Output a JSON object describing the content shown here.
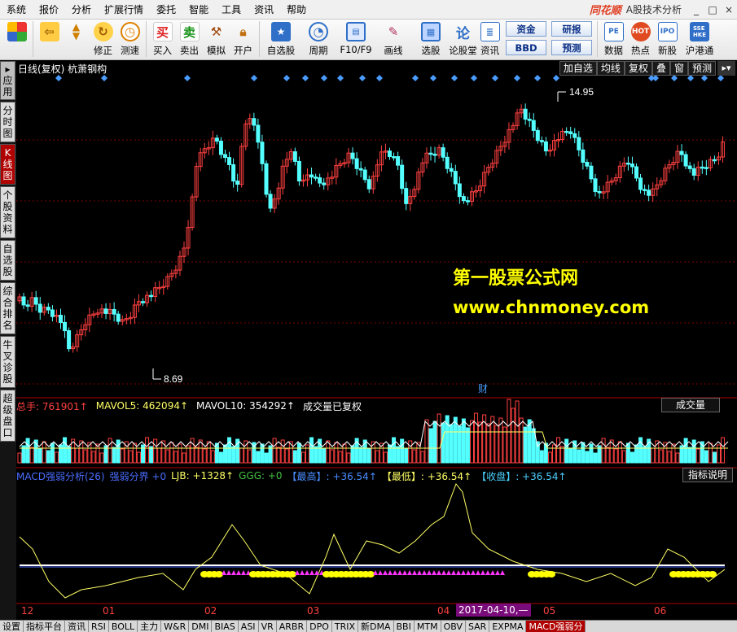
{
  "menu": [
    "系统",
    "报价",
    "分析",
    "扩展行情",
    "委托",
    "智能",
    "工具",
    "资讯",
    "帮助"
  ],
  "brand": "同花顺",
  "brand_sub": "A股技术分析",
  "window_buttons": [
    "_",
    "□",
    "×"
  ],
  "toolbar": {
    "buttons": [
      "修正",
      "测速",
      "买入",
      "卖出",
      "模拟",
      "开户",
      "自选股",
      "周期",
      "F10/F9",
      "画线",
      "选股",
      "论股堂",
      "资讯",
      "数据",
      "热点",
      "新股",
      "沪港通"
    ],
    "mini_buttons": [
      "资金",
      "BBD",
      "研报",
      "预测"
    ]
  },
  "left_tabs": [
    "应用",
    "分时图",
    "K线图",
    "个股资料",
    "自选股",
    "综合排名",
    "牛叉诊股",
    "超级盘口"
  ],
  "chart": {
    "title": "日线(复权)  杭萧钢构",
    "top_right_buttons": [
      "加自选",
      "均线",
      "复权",
      "叠",
      "窗",
      "预测"
    ],
    "high_label": "14.95",
    "low_label": "8.69",
    "cai_label": "财",
    "watermark_cn": "第一股票公式网",
    "watermark_url": "www.chnmoney.com",
    "volume_header": {
      "zongshou": "总手: 761901↑",
      "mavol5": "MAVOL5: 462094↑",
      "mavol10": "MAVOL10: 354292↑",
      "note": "成交量已复权",
      "selector": "成交量"
    },
    "indicator_header": {
      "name": "MACD强弱分析(26)",
      "strong": "强弱分界 +0",
      "ljb": "LJB: +1328↑",
      "ggg": "GGG: +0",
      "zuigao": "【最高】: +36.54↑",
      "zuidi": "【最低】: +36.54↑",
      "shoupan": "【收盘】: +36.54↑",
      "help": "指标说明"
    },
    "x_labels": [
      "12",
      "01",
      "02",
      "03",
      "04",
      "05",
      "06"
    ],
    "cursor_date": "2017-04-10,—"
  },
  "bottom_tabs": [
    "设置",
    "指标平台",
    "资讯",
    "RSI",
    "BOLL",
    "主力",
    "W&R",
    "DMI",
    "BIAS",
    "ASI",
    "VR",
    "ARBR",
    "DPO",
    "TRIX",
    "新DMA",
    "BBI",
    "MTM",
    "OBV",
    "SAR",
    "EXPMA",
    "MACD强弱分"
  ],
  "colors": {
    "up": "#ff4040",
    "down": "#54ffff",
    "grid": "#7a0000",
    "accent": "#b00000"
  },
  "chart_data": {
    "type": "candlestick",
    "title": "日线(复权) 杭萧钢构",
    "price_range": [
      8.69,
      14.95
    ],
    "high": 14.95,
    "low": 8.69
  }
}
